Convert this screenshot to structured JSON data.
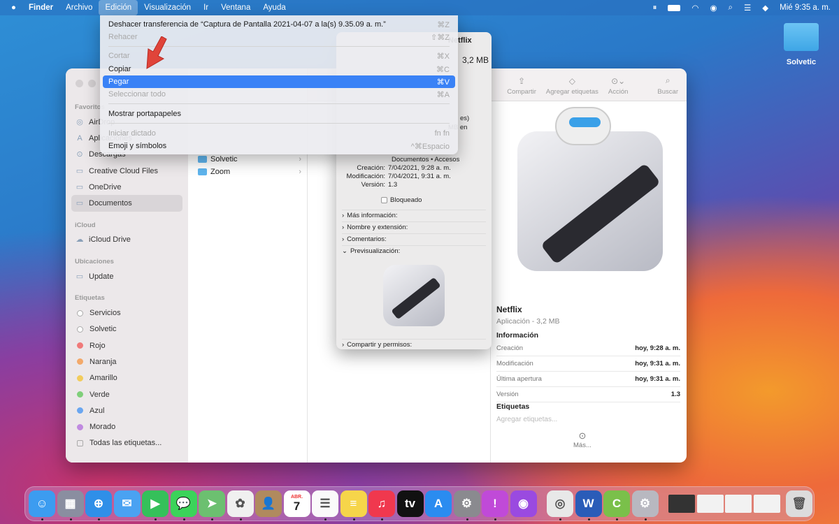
{
  "menubar": {
    "apple": "",
    "app": "Finder",
    "items": [
      "Archivo",
      "Edición",
      "Visualización",
      "Ir",
      "Ventana",
      "Ayuda"
    ],
    "clock": "Mié 9:35 a. m."
  },
  "desktop": {
    "folder_label": "Solvetic"
  },
  "edit_menu": {
    "items": [
      {
        "label": "Deshacer transferencia de “Captura de Pantalla 2021-04-07 a la(s) 9.35.09 a. m.”",
        "shortcut": "⌘Z",
        "disabled": false
      },
      {
        "label": "Rehacer",
        "shortcut": "⇧⌘Z",
        "disabled": true
      },
      {
        "label": "Cortar",
        "shortcut": "⌘X",
        "disabled": true
      },
      {
        "label": "Copiar",
        "shortcut": "⌘C",
        "disabled": false
      },
      {
        "label": "Pegar",
        "shortcut": "⌘V",
        "disabled": false,
        "highlighted": true
      },
      {
        "label": "Seleccionar todo",
        "shortcut": "⌘A",
        "disabled": true
      },
      {
        "label": "Mostrar portapapeles",
        "shortcut": "",
        "disabled": false
      },
      {
        "label": "Iniciar dictado",
        "shortcut": "fn fn",
        "disabled": true
      },
      {
        "label": "Emoji y símbolos",
        "shortcut": "^⌘Espacio",
        "disabled": false
      }
    ]
  },
  "sidebar": {
    "favorites_header": "Favoritos",
    "favorites": [
      "AirDrop",
      "Aplicaciones",
      "Descargas",
      "Creative Cloud Files",
      "OneDrive",
      "Documentos"
    ],
    "icloud_header": "iCloud",
    "icloud": [
      "iCloud Drive"
    ],
    "locations_header": "Ubicaciones",
    "locations": [
      "Update"
    ],
    "tags_header": "Etiquetas",
    "tags": [
      {
        "label": "Servicios",
        "color": "#ffffff"
      },
      {
        "label": "Solvetic",
        "color": "#ffffff"
      },
      {
        "label": "Rojo",
        "color": "#f07a7a"
      },
      {
        "label": "Naranja",
        "color": "#f3a96a"
      },
      {
        "label": "Amarillo",
        "color": "#f2cc5c"
      },
      {
        "label": "Verde",
        "color": "#7fcf7a"
      },
      {
        "label": "Azul",
        "color": "#6aa6f0"
      },
      {
        "label": "Morado",
        "color": "#c08ae0"
      },
      {
        "label": "Todas las etiquetas...",
        "color": ""
      }
    ]
  },
  "column1": [
    "Solvetic",
    "Zoom"
  ],
  "toolbar": {
    "share": "Compartir",
    "tags": "Agregar etiquetas",
    "action": "Acción",
    "search": "Buscar"
  },
  "preview": {
    "name": "Netflix",
    "kind": "Aplicación - 3,2 MB",
    "info_header": "Información",
    "rows": [
      {
        "k": "Creación",
        "v": "hoy, 9:28 a. m."
      },
      {
        "k": "Modificación",
        "v": "hoy, 9:31 a. m."
      },
      {
        "k": "Última apertura",
        "v": "hoy, 9:31 a. m."
      },
      {
        "k": "Versión",
        "v": "1.3"
      }
    ],
    "tags_header": "Etiquetas",
    "tags_placeholder": "Agregar etiquetas...",
    "more": "Más..."
  },
  "info_window": {
    "title": "Netflix",
    "size": "3,2 MB",
    "partial1": "es)",
    "partial2": "MB en",
    "where": "Documentos • Accesos",
    "rows": [
      {
        "k": "Creación:",
        "v": "7/04/2021, 9:28 a. m."
      },
      {
        "k": "Modificación:",
        "v": "7/04/2021, 9:31 a. m."
      },
      {
        "k": "Versión:",
        "v": "1.3"
      }
    ],
    "locked": "Bloqueado",
    "sections": [
      "Más información:",
      "Nombre y extensión:",
      "Comentarios:",
      "Previsualización:"
    ],
    "sharing": "Compartir y permisos:"
  },
  "dock": [
    {
      "name": "finder",
      "color": "#3c9cf0",
      "glyph": "☺"
    },
    {
      "name": "launchpad",
      "color": "#8a8ea0",
      "glyph": "▦"
    },
    {
      "name": "safari",
      "color": "#2f8fe8",
      "glyph": "⊕"
    },
    {
      "name": "mail",
      "color": "#4aa2f2",
      "glyph": "✉"
    },
    {
      "name": "facetime",
      "color": "#35c05a",
      "glyph": "▶"
    },
    {
      "name": "messages",
      "color": "#3bd35a",
      "glyph": "💬"
    },
    {
      "name": "maps",
      "color": "#6cc070",
      "glyph": "➤"
    },
    {
      "name": "photos",
      "color": "#f0f0f0",
      "glyph": "✿"
    },
    {
      "name": "contacts",
      "color": "#b08a5e",
      "glyph": "👤"
    },
    {
      "name": "calendar",
      "color": "#ffffff",
      "glyph": "7",
      "sub": "ABR."
    },
    {
      "name": "reminders",
      "color": "#fafafa",
      "glyph": "☰"
    },
    {
      "name": "notes",
      "color": "#f6d54a",
      "glyph": "≡"
    },
    {
      "name": "music",
      "color": "#f0384e",
      "glyph": "♫"
    },
    {
      "name": "tv",
      "color": "#111111",
      "glyph": "tv"
    },
    {
      "name": "app-store",
      "color": "#2a8cf0",
      "glyph": "A"
    },
    {
      "name": "system-preferences",
      "color": "#8a8a8f",
      "glyph": "⚙"
    },
    {
      "name": "feedback",
      "color": "#c04ad8",
      "glyph": "!"
    },
    {
      "name": "podcasts",
      "color": "#9a4ae0",
      "glyph": "◉"
    },
    {
      "name": "chrome",
      "color": "#e8e8e8",
      "glyph": "◎"
    },
    {
      "name": "word",
      "color": "#2a5cb8",
      "glyph": "W"
    },
    {
      "name": "camtasia",
      "color": "#7ac04a",
      "glyph": "C"
    },
    {
      "name": "automator",
      "color": "#b8b8c0",
      "glyph": "⚙"
    },
    {
      "name": "screenshot-1",
      "color": "#333333",
      "glyph": ""
    },
    {
      "name": "screenshot-2",
      "color": "#f2f2f2",
      "glyph": ""
    },
    {
      "name": "screenshot-3",
      "color": "#f2f2f2",
      "glyph": ""
    },
    {
      "name": "screenshot-4",
      "color": "#f2f2f2",
      "glyph": ""
    },
    {
      "name": "trash",
      "color": "#dcdcdc",
      "glyph": "🗑"
    }
  ]
}
